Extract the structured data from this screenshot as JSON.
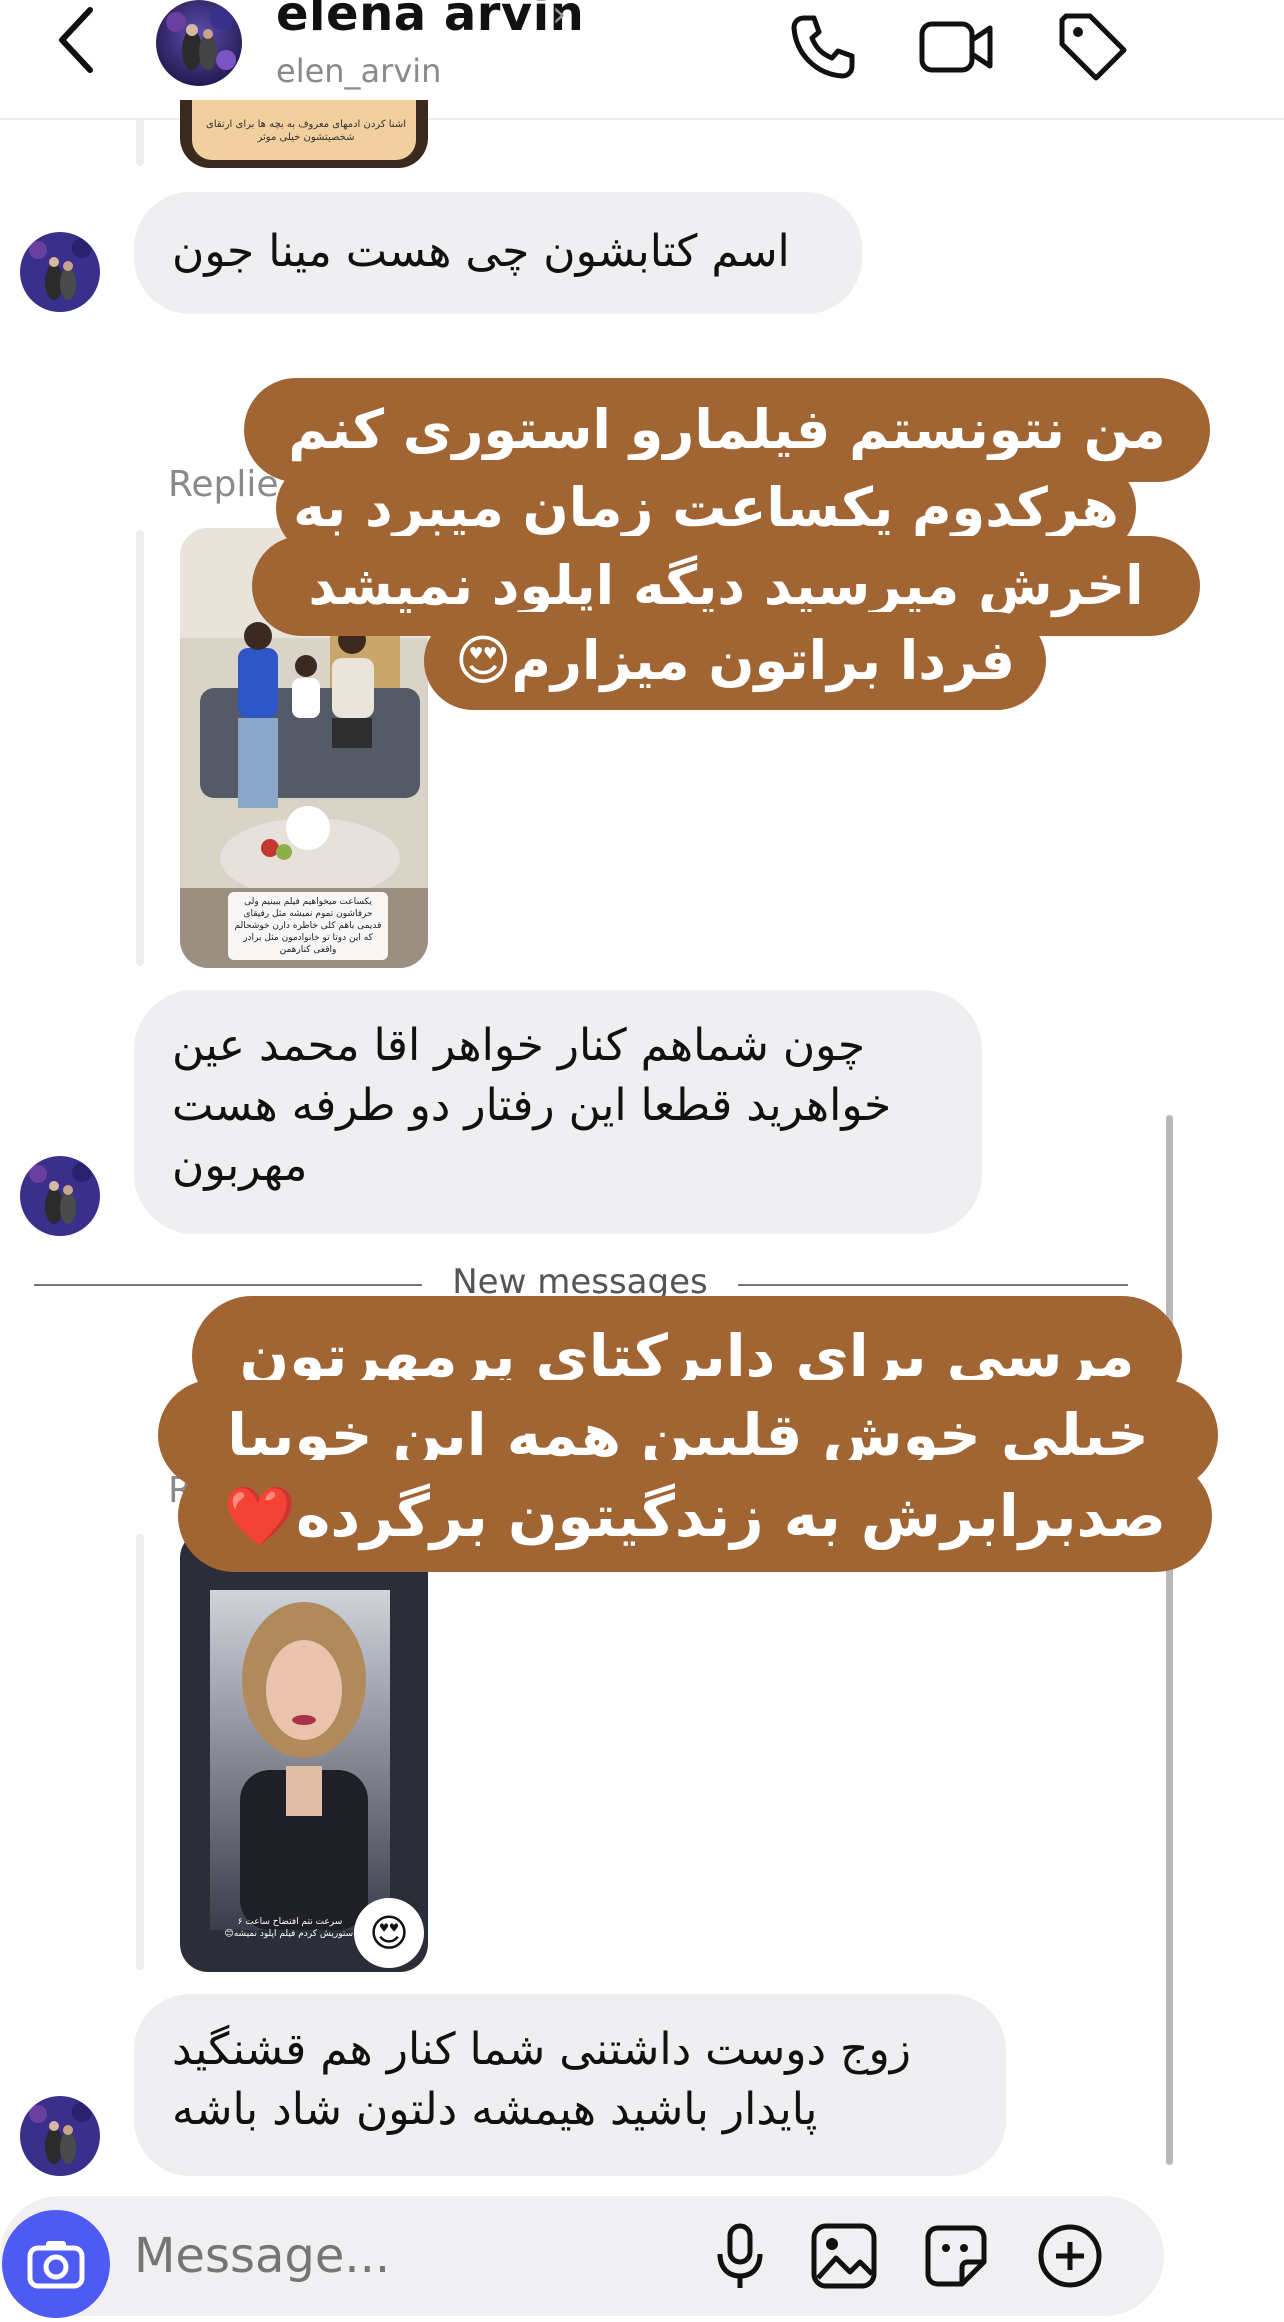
{
  "header": {
    "name": "elena arvin",
    "chevron": "›",
    "username": "elen_arvin",
    "icons": [
      "back-icon",
      "phone-icon",
      "video-camera-icon",
      "tag-icon"
    ]
  },
  "thread": {
    "story1_caption": "اشنا کردن ادمهای معروف به بچه ها برای ارتقای شخصیتشون خیلی موثر",
    "msg1": "اسم کتابشون چی هست مینا جون",
    "reply_label": "Replie",
    "story2_caption": "یکساعت میخواهیم فیلم ببینیم ولی حرفاشون تموم نمیشه مثل رفیقای قدیمی باهم کلی خاطره دارن خوشحالم که این دوتا تو خانوادمون مثل برادر واقعی کنارهمن",
    "msg2": "چون شماهم کنار خواهر  اقا محمد عین خواهرید قطعا این رفتار دو طرفه هست مهربون",
    "divider": "New messages",
    "reply_label2": "R",
    "story3_caption": "سرعت نتم افتضاح ساعت ۶ استوریش کردم فیلم اپلود نمیشه😊",
    "story3_reaction": "😍",
    "msg3": "زوج دوست داشتنی شما کنار هم قشنگید پایدار باشید هیمشه دلتون شاد باشه"
  },
  "overlay1": {
    "lines": [
      "من نتونستم فیلمارو استوری کنم",
      "هرکدوم یکساعت زمان میبرد به",
      "اخرش میرسید دیگه اپلود نمیشد",
      "فردا براتون میزارم😍"
    ]
  },
  "overlay2": {
    "lines": [
      "مرسی برای دایرکتای پرمهرتون",
      "خیلی خوش قلبین همه این خوبیا",
      "صدبرابرش به زندگیتون برگرده❤️"
    ]
  },
  "composer": {
    "placeholder": "Message...",
    "icons": [
      "camera-icon",
      "microphone-icon",
      "image-icon",
      "sticker-icon",
      "plus-circle-icon"
    ]
  },
  "colors": {
    "overlay": "#a16433",
    "bubble": "#efeff1",
    "camera": "#4e5bf2"
  }
}
